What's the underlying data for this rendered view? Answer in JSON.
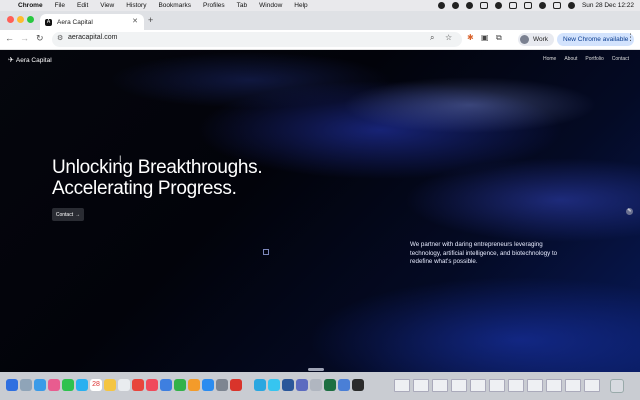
{
  "menubar": {
    "app_name": "Chrome",
    "items": [
      "File",
      "Edit",
      "View",
      "History",
      "Bookmarks",
      "Profiles",
      "Tab",
      "Window",
      "Help"
    ],
    "datetime": "Sun 28 Dec  12:22"
  },
  "browser": {
    "tab_title": "Aera Capital",
    "tab_favicon": "A",
    "url": "aeracapital.com",
    "profile_label": "Work",
    "update_label": "New Chrome available"
  },
  "site": {
    "logo_text": "Aera Capital",
    "nav": [
      "Home",
      "About",
      "Portfolio",
      "Contact"
    ],
    "headline_line1": "Unlocking Breakthroughs.",
    "headline_line2": "Accelerating Progress.",
    "cta_label": "Contact",
    "cta_arrow": "→",
    "description": "We partner with daring entrepreneurs leveraging technology, artificial intelligence, and biotechnology to redefine what's possible."
  },
  "dock": {
    "calendar_day": "28"
  },
  "colors": {
    "accent": "#1a3bd4",
    "update_pill": "#d3e3fd",
    "page_background": "#03040c"
  }
}
